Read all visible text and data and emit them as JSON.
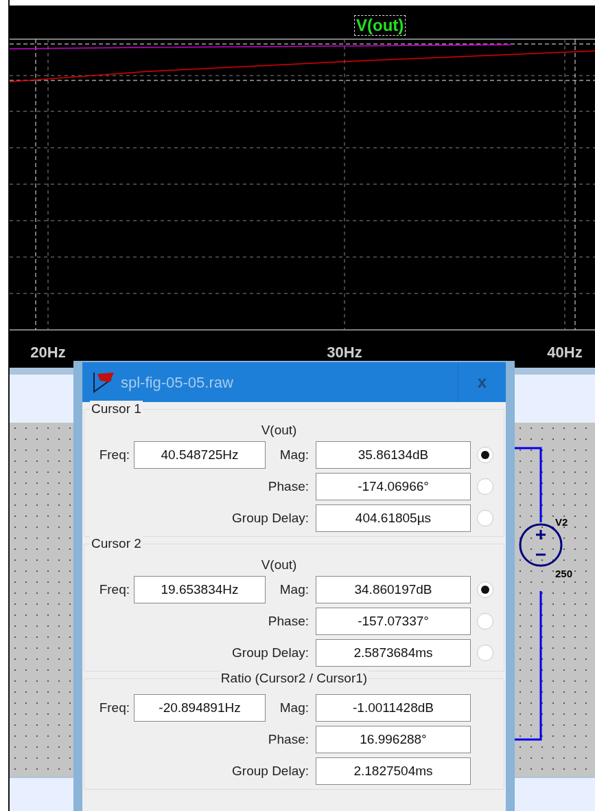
{
  "plot": {
    "trace_label": "V(out)",
    "x_tick_labels": [
      "20Hz",
      "30Hz",
      "40Hz"
    ]
  },
  "schematic": {
    "source_name": "V2",
    "source_value": "250"
  },
  "dialog": {
    "title": "spl-fig-05-05.raw",
    "close": "x",
    "sections": [
      {
        "kind": "cursor",
        "title": "Cursor 1",
        "trace": "V(out)",
        "freq_label": "Freq:",
        "freq": "40.548725Hz",
        "rows": [
          {
            "label": "Mag:",
            "value": "35.86134dB",
            "selected": true
          },
          {
            "label": "Phase:",
            "value": "-174.06966°",
            "selected": false
          },
          {
            "label": "Group Delay:",
            "value": "404.61805µs",
            "selected": false
          }
        ]
      },
      {
        "kind": "cursor",
        "title": "Cursor 2",
        "trace": "V(out)",
        "freq_label": "Freq:",
        "freq": "19.653834Hz",
        "rows": [
          {
            "label": "Mag:",
            "value": "34.860197dB",
            "selected": true
          },
          {
            "label": "Phase:",
            "value": "-157.07337°",
            "selected": false
          },
          {
            "label": "Group Delay:",
            "value": "2.5873684ms",
            "selected": false
          }
        ]
      },
      {
        "kind": "ratio",
        "title": "Ratio (Cursor2 / Cursor1)",
        "freq_label": "Freq:",
        "freq": "-20.894891Hz",
        "rows": [
          {
            "label": "Mag:",
            "value": "-1.0011428dB"
          },
          {
            "label": "Phase:",
            "value": "16.996288°"
          },
          {
            "label": "Group Delay:",
            "value": "2.1827504ms"
          }
        ]
      }
    ]
  }
}
